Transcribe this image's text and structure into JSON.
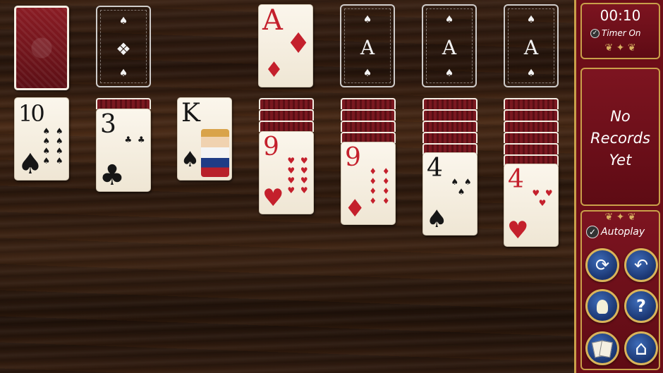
{
  "stock": {
    "label": ""
  },
  "waste": {
    "label": ""
  },
  "foundations": [
    {
      "rank": "A",
      "suit": "♦",
      "color": "red",
      "filled": true
    },
    {
      "rank": "A",
      "filled": false
    },
    {
      "rank": "A",
      "filled": false
    },
    {
      "rank": "A",
      "filled": false
    }
  ],
  "tableau": [
    {
      "hidden": 0,
      "rank": "10",
      "suit": "♠",
      "color": "black",
      "pips": "♠ ♠ ♠ ♠ ♠ ♠ ♠ ♠"
    },
    {
      "hidden": 1,
      "rank": "3",
      "suit": "♣",
      "color": "black",
      "pips": "♣ ♣"
    },
    {
      "hidden": 0,
      "rank": "K",
      "suit": "♠",
      "color": "black",
      "pips": ""
    },
    {
      "hidden": 3,
      "rank": "9",
      "suit": "♥",
      "color": "red",
      "pips": "♥ ♥ ♥ ♥ ♥ ♥ ♥ ♥"
    },
    {
      "hidden": 4,
      "rank": "9",
      "suit": "♦",
      "color": "red",
      "pips": "♦ ♦ ♦ ♦ ♦ ♦ ♦ ♦"
    },
    {
      "hidden": 5,
      "rank": "4",
      "suit": "♠",
      "color": "black",
      "pips": "♠ ♠ ♠"
    },
    {
      "hidden": 6,
      "rank": "4",
      "suit": "♥",
      "color": "red",
      "pips": "♥ ♥ ♥"
    }
  ],
  "sidebar": {
    "timer": "00:10",
    "timer_on": "Timer On",
    "records_line1": "No",
    "records_line2": "Records",
    "records_line3": "Yet",
    "autoplay": "Autoplay",
    "buttons": [
      {
        "icon": "refresh-icon",
        "glyph": "⟳"
      },
      {
        "icon": "undo-icon",
        "glyph": "↶"
      },
      {
        "icon": "hint-lightbulb-icon",
        "glyph": "💡"
      },
      {
        "icon": "help-icon",
        "glyph": "?"
      },
      {
        "icon": "cards-icon",
        "glyph": "🂠"
      },
      {
        "icon": "home-icon",
        "glyph": "⌂"
      }
    ]
  },
  "colors": {
    "red_suit": "#c4202c",
    "black_suit": "#161616",
    "sidebar": "#6d0e18",
    "gold": "#c9a04a",
    "button": "#1a3570"
  }
}
